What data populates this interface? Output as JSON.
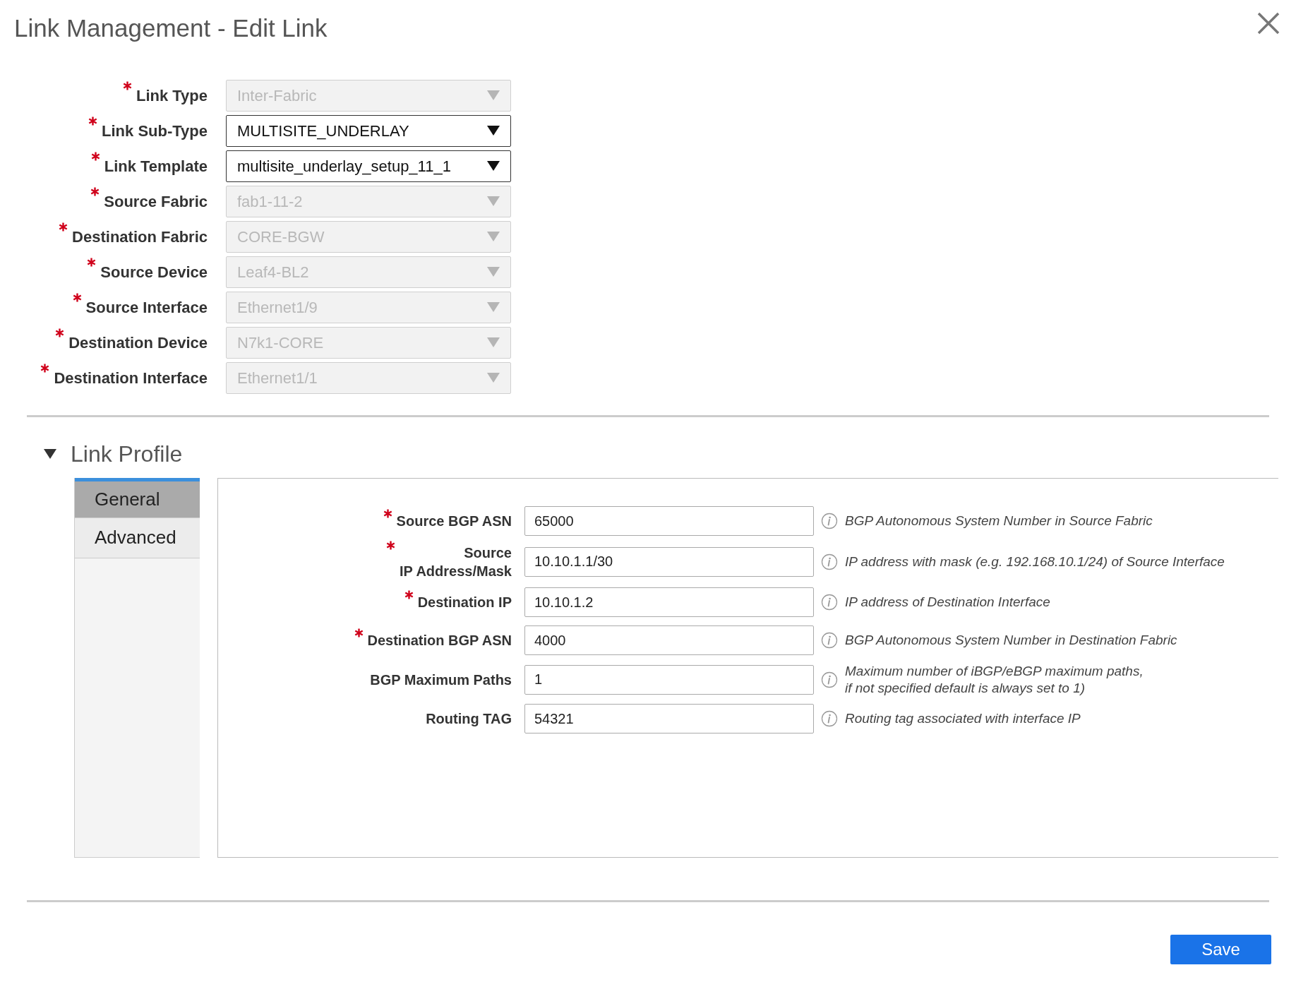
{
  "dialog": {
    "title": "Link Management - Edit Link"
  },
  "fields": [
    {
      "label": "Link Type",
      "required": true,
      "value": "Inter-Fabric",
      "disabled": true
    },
    {
      "label": "Link Sub-Type",
      "required": true,
      "value": "MULTISITE_UNDERLAY",
      "disabled": false
    },
    {
      "label": "Link Template",
      "required": true,
      "value": "multisite_underlay_setup_11_1",
      "disabled": false
    },
    {
      "label": "Source Fabric",
      "required": true,
      "value": "fab1-11-2",
      "disabled": true
    },
    {
      "label": "Destination Fabric",
      "required": true,
      "value": "CORE-BGW",
      "disabled": true
    },
    {
      "label": "Source Device",
      "required": true,
      "value": "Leaf4-BL2",
      "disabled": true
    },
    {
      "label": "Source Interface",
      "required": true,
      "value": "Ethernet1/9",
      "disabled": true
    },
    {
      "label": "Destination Device",
      "required": true,
      "value": "N7k1-CORE",
      "disabled": true
    },
    {
      "label": "Destination Interface",
      "required": true,
      "value": "Ethernet1/1",
      "disabled": true
    }
  ],
  "profile": {
    "title": "Link Profile",
    "expanded": true,
    "tabs": [
      {
        "label": "General",
        "selected": true
      },
      {
        "label": "Advanced",
        "selected": false
      }
    ],
    "params": [
      {
        "label": "Source BGP ASN",
        "required": true,
        "value": "65000",
        "help": "BGP Autonomous System Number in Source Fabric"
      },
      {
        "label": "Source\nIP Address/Mask",
        "required": true,
        "value": "10.10.1.1/30",
        "help": "IP address with mask (e.g. 192.168.10.1/24) of Source Interface"
      },
      {
        "label": "Destination IP",
        "required": true,
        "value": "10.10.1.2",
        "help": "IP address of Destination Interface"
      },
      {
        "label": "Destination BGP ASN",
        "required": true,
        "value": "4000",
        "help": "BGP Autonomous System Number in Destination Fabric"
      },
      {
        "label": "BGP Maximum Paths",
        "required": false,
        "value": "1",
        "help": "Maximum number of iBGP/eBGP maximum paths,\nif not specified default is always set to 1)"
      },
      {
        "label": "Routing TAG",
        "required": false,
        "value": "54321",
        "help": "Routing tag associated with interface IP"
      }
    ]
  },
  "save_button": "Save"
}
